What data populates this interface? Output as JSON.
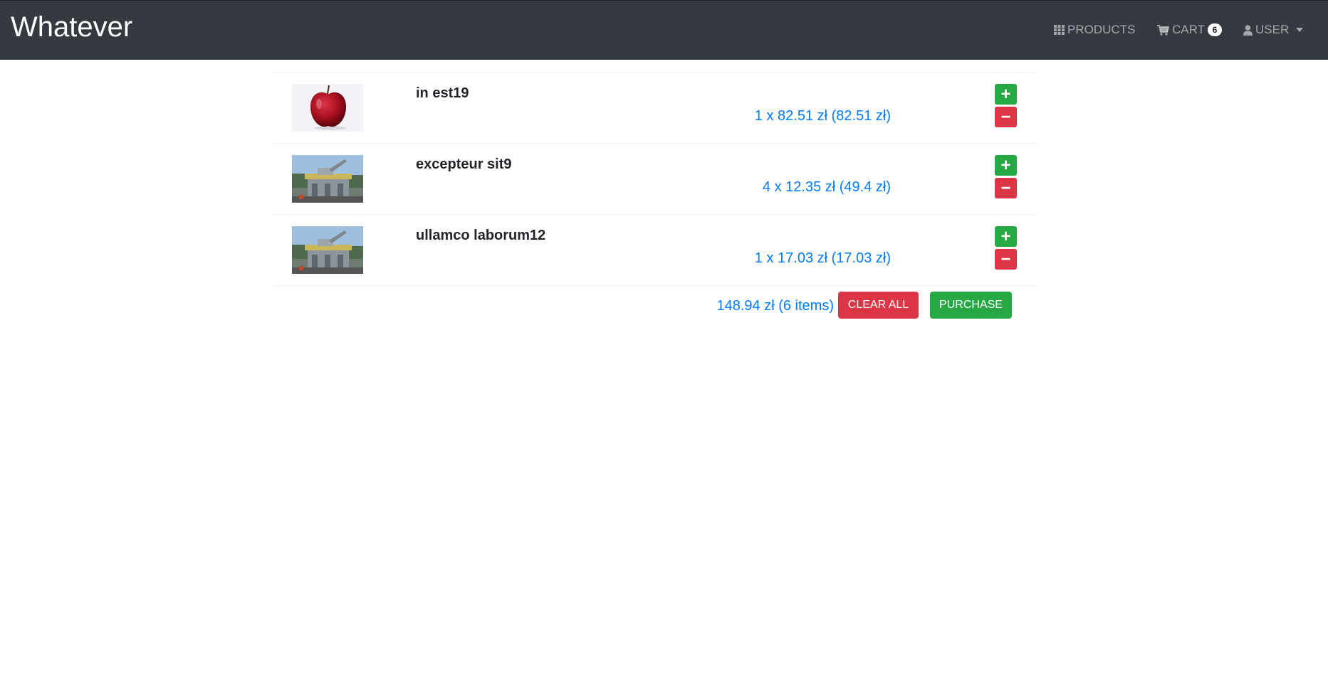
{
  "navbar": {
    "brand": "Whatever",
    "products_label": "PRODUCTS",
    "cart_label": "CART",
    "cart_count": "6",
    "user_label": "USER"
  },
  "cart": {
    "items": [
      {
        "name": "in est19",
        "price_line": "1 x 82.51 zł (82.51 zł)",
        "image": "apple"
      },
      {
        "name": "excepteur sit9",
        "price_line": "4 x 12.35 zł (49.4 zł)",
        "image": "building-with-cannon"
      },
      {
        "name": "ullamco laborum12",
        "price_line": "1 x 17.03 zł (17.03 zł)",
        "image": "building-with-cannon"
      }
    ],
    "plus_label": "+",
    "minus_label": "−",
    "total": "148.94 zł (6 items)",
    "clear_label": "CLEAR ALL",
    "purchase_label": "PURCHASE"
  },
  "colors": {
    "navbar_bg": "#343a40",
    "link_blue": "#007bff",
    "success": "#28a745",
    "danger": "#dc3545"
  }
}
